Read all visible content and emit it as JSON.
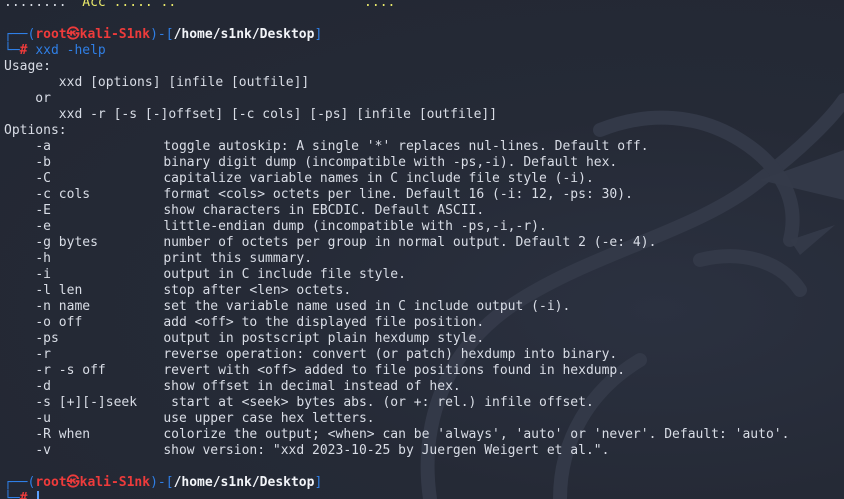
{
  "top_partial": {
    "text_left": "........",
    "text_mid": "Acc ..... ..",
    "text_right": "...."
  },
  "prompt1": {
    "box_open": "┌──(",
    "user": "root",
    "at": "㉿",
    "host": "kali-S1nk",
    "box_mid": ")-[",
    "path": "/home/s1nk/Desktop",
    "box_close": "]",
    "prefix": "└─",
    "hash": "#",
    "command": "xxd -help"
  },
  "usage": {
    "header": "Usage:",
    "line1": "       xxd [options] [infile [outfile]]",
    "or": "    or",
    "line2": "       xxd -r [-s [-]offset] [-c cols] [-ps] [infile [outfile]]"
  },
  "options_header": "Options:",
  "options": [
    {
      "flag": "-a",
      "desc": "toggle autoskip: A single '*' replaces nul-lines. Default off."
    },
    {
      "flag": "-b",
      "desc": "binary digit dump (incompatible with -ps,-i). Default hex."
    },
    {
      "flag": "-C",
      "desc": "capitalize variable names in C include file style (-i)."
    },
    {
      "flag": "-c cols",
      "desc": "format <cols> octets per line. Default 16 (-i: 12, -ps: 30)."
    },
    {
      "flag": "-E",
      "desc": "show characters in EBCDIC. Default ASCII."
    },
    {
      "flag": "-e",
      "desc": "little-endian dump (incompatible with -ps,-i,-r)."
    },
    {
      "flag": "-g bytes",
      "desc": "number of octets per group in normal output. Default 2 (-e: 4)."
    },
    {
      "flag": "-h",
      "desc": "print this summary."
    },
    {
      "flag": "-i",
      "desc": "output in C include file style."
    },
    {
      "flag": "-l len",
      "desc": "stop after <len> octets."
    },
    {
      "flag": "-n name",
      "desc": "set the variable name used in C include output (-i)."
    },
    {
      "flag": "-o off",
      "desc": "add <off> to the displayed file position."
    },
    {
      "flag": "-ps",
      "desc": "output in postscript plain hexdump style."
    },
    {
      "flag": "-r",
      "desc": "reverse operation: convert (or patch) hexdump into binary."
    },
    {
      "flag": "-r -s off",
      "desc": "revert with <off> added to file positions found in hexdump."
    },
    {
      "flag": "-d",
      "desc": "show offset in decimal instead of hex."
    },
    {
      "flag": "-s [+][-]seek",
      "desc": " start at <seek> bytes abs. (or +: rel.) infile offset."
    },
    {
      "flag": "-u",
      "desc": "use upper case hex letters."
    },
    {
      "flag": "-R when",
      "desc": "colorize the output; <when> can be 'always', 'auto' or 'never'. Default: 'auto'."
    },
    {
      "flag": "-v",
      "desc": "show version: \"xxd 2023-10-25 by Juergen Weigert et al.\"."
    }
  ],
  "prompt2": {
    "box_open": "┌──(",
    "user": "root",
    "at": "㉿",
    "host": "kali-S1nk",
    "box_mid": ")-[",
    "path": "/home/s1nk/Desktop",
    "box_close": "]",
    "prefix": "└─",
    "hash": "#"
  },
  "colors": {
    "background": "#242935",
    "prompt_blue": "#2f7fe6",
    "prompt_red": "#ee3b3b",
    "text": "#d9dde6"
  }
}
